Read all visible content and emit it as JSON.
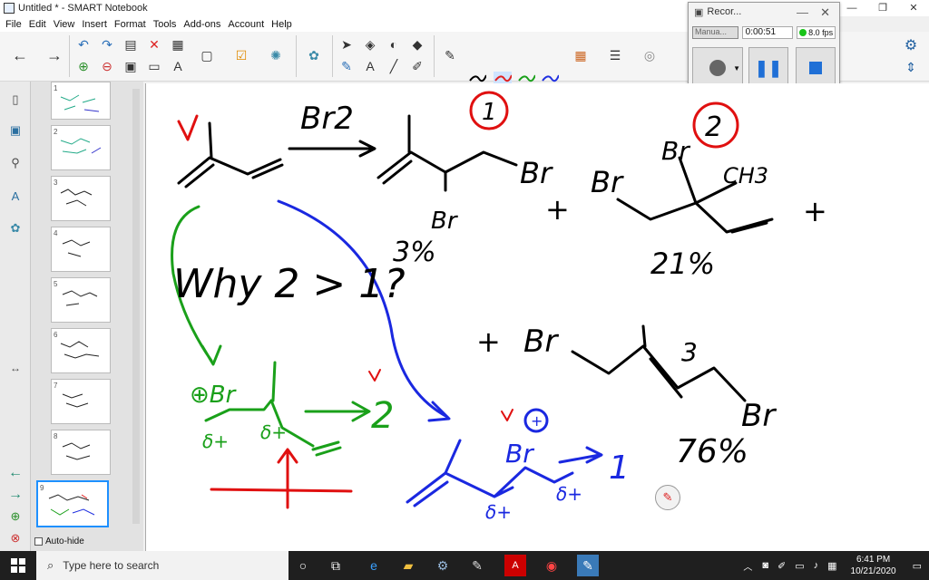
{
  "window": {
    "title": "Untitled * - SMART Notebook",
    "controls": [
      "—",
      "❐",
      "✕"
    ]
  },
  "menu": [
    "File",
    "Edit",
    "View",
    "Insert",
    "Format",
    "Tools",
    "Add-ons",
    "Account",
    "Help"
  ],
  "recorder": {
    "title": "Recor...",
    "mode": "Manua...",
    "elapsed": "0:00:51",
    "fps": "8.0 fps"
  },
  "sidebar": {
    "thumbs": [
      "1",
      "2",
      "3",
      "4",
      "5",
      "6",
      "7",
      "8",
      "9"
    ],
    "autohide_label": "Auto-hide"
  },
  "canvas": {
    "reagent": "Br2",
    "label_1": "1",
    "label_2": "2",
    "label_3": "3",
    "pct_1": "3%",
    "pct_2": "21%",
    "pct_3": "76%",
    "question": "Why 2 > 1?",
    "br_a": "Br",
    "br_b": "Br",
    "br_c": "Br",
    "br_d": "Br",
    "br_e": "Br",
    "ch3": "CH3",
    "br_plus_green": "⊕Br",
    "br_plus_blue": "Br",
    "delta_1": "δ+",
    "delta_2": "δ+",
    "delta_3": "δ+",
    "delta_4": "δ+",
    "arrow_to_2": "2",
    "arrow_to_1": "1",
    "check": "v",
    "plus": "+"
  },
  "taskbar": {
    "search_placeholder": "Type here to search",
    "time": "6:41 PM",
    "date": "10/21/2020"
  }
}
